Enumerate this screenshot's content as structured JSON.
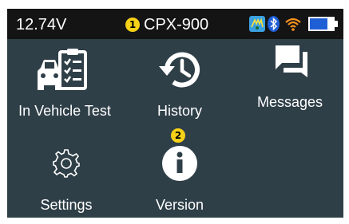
{
  "status_bar": {
    "voltage": "12.74V",
    "callout": "1",
    "model": "CPX-900",
    "icons": [
      "vehicle-link-icon",
      "bluetooth-icon",
      "wifi-icon",
      "battery-icon"
    ]
  },
  "menu": {
    "items": [
      {
        "label": "In Vehicle Test",
        "icon": "vehicle-test-icon"
      },
      {
        "label": "History",
        "icon": "history-icon"
      },
      {
        "label": "Messages",
        "icon": "messages-icon"
      },
      {
        "label": "Settings",
        "icon": "gear-icon"
      },
      {
        "label": "Version",
        "icon": "info-icon",
        "callout": "2"
      }
    ]
  },
  "colors": {
    "background": "#2f3f48",
    "status_bar": "#141414",
    "callout": "#f7d117",
    "wifi": "#f7931e",
    "battery": "#1f5fd6",
    "link_icon": "#3aa0e0"
  }
}
